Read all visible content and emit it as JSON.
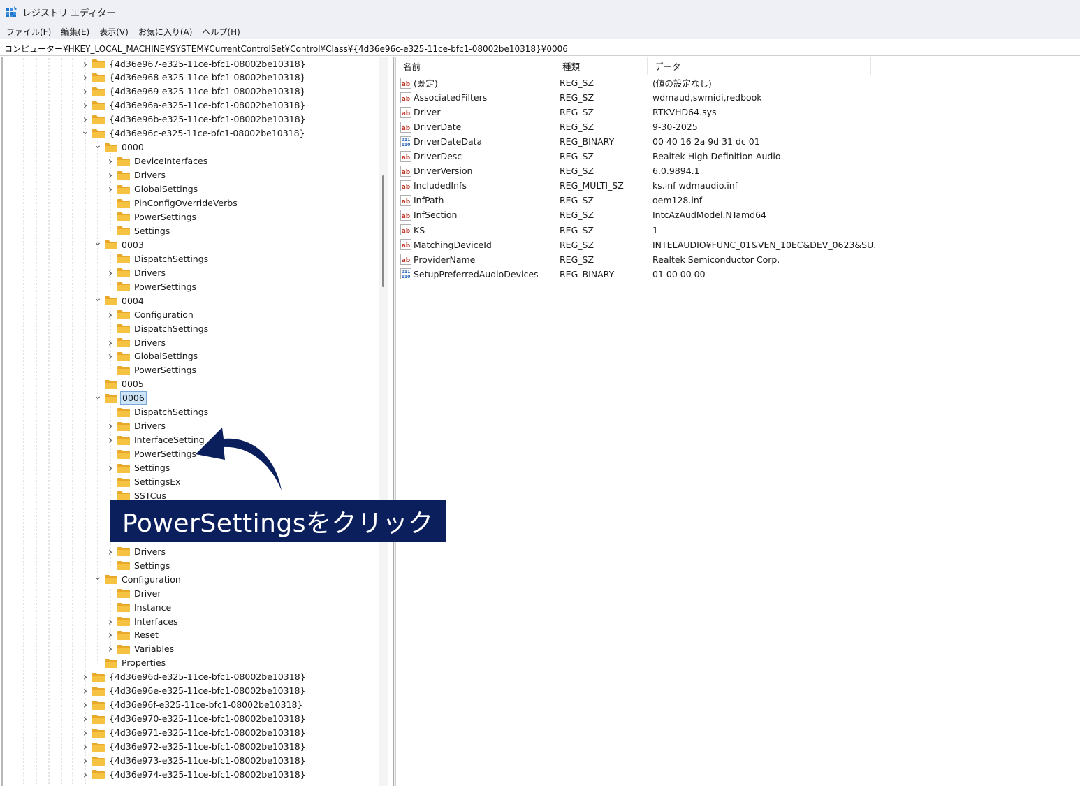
{
  "window": {
    "title": "レジストリ エディター"
  },
  "menu": [
    "ファイル(F)",
    "編集(E)",
    "表示(V)",
    "お気に入り(A)",
    "ヘルプ(H)"
  ],
  "address": "コンピューター¥HKEY_LOCAL_MACHINE¥SYSTEM¥CurrentControlSet¥Control¥Class¥{4d36e96c-e325-11ce-bfc1-08002be10318}¥0006",
  "tree": [
    {
      "label": "{4d36e967-e325-11ce-bfc1-08002be10318}",
      "level": 0,
      "chevron": "right"
    },
    {
      "label": "{4d36e968-e325-11ce-bfc1-08002be10318}",
      "level": 0,
      "chevron": "right"
    },
    {
      "label": "{4d36e969-e325-11ce-bfc1-08002be10318}",
      "level": 0,
      "chevron": "right"
    },
    {
      "label": "{4d36e96a-e325-11ce-bfc1-08002be10318}",
      "level": 0,
      "chevron": "right"
    },
    {
      "label": "{4d36e96b-e325-11ce-bfc1-08002be10318}",
      "level": 0,
      "chevron": "right"
    },
    {
      "label": "{4d36e96c-e325-11ce-bfc1-08002be10318}",
      "level": 0,
      "chevron": "down"
    },
    {
      "label": "0000",
      "level": 1,
      "chevron": "down"
    },
    {
      "label": "DeviceInterfaces",
      "level": 2,
      "chevron": "right"
    },
    {
      "label": "Drivers",
      "level": 2,
      "chevron": "right"
    },
    {
      "label": "GlobalSettings",
      "level": 2,
      "chevron": "right"
    },
    {
      "label": "PinConfigOverrideVerbs",
      "level": 2,
      "chevron": "none"
    },
    {
      "label": "PowerSettings",
      "level": 2,
      "chevron": "none"
    },
    {
      "label": "Settings",
      "level": 2,
      "chevron": "none"
    },
    {
      "label": "0003",
      "level": 1,
      "chevron": "down"
    },
    {
      "label": "DispatchSettings",
      "level": 2,
      "chevron": "none"
    },
    {
      "label": "Drivers",
      "level": 2,
      "chevron": "right"
    },
    {
      "label": "PowerSettings",
      "level": 2,
      "chevron": "none"
    },
    {
      "label": "0004",
      "level": 1,
      "chevron": "down"
    },
    {
      "label": "Configuration",
      "level": 2,
      "chevron": "right"
    },
    {
      "label": "DispatchSettings",
      "level": 2,
      "chevron": "none"
    },
    {
      "label": "Drivers",
      "level": 2,
      "chevron": "right"
    },
    {
      "label": "GlobalSettings",
      "level": 2,
      "chevron": "right"
    },
    {
      "label": "PowerSettings",
      "level": 2,
      "chevron": "none"
    },
    {
      "label": "0005",
      "level": 1,
      "chevron": "none"
    },
    {
      "label": "0006",
      "level": 1,
      "chevron": "down",
      "selected": true
    },
    {
      "label": "DispatchSettings",
      "level": 2,
      "chevron": "none"
    },
    {
      "label": "Drivers",
      "level": 2,
      "chevron": "right"
    },
    {
      "label": "InterfaceSetting",
      "level": 2,
      "chevron": "right"
    },
    {
      "label": "PowerSettings",
      "level": 2,
      "chevron": "none"
    },
    {
      "label": "Settings",
      "level": 2,
      "chevron": "right"
    },
    {
      "label": "SettingsEx",
      "level": 2,
      "chevron": "none"
    },
    {
      "label": "SSTCus",
      "level": 2,
      "chevron": "none"
    },
    {
      "label": "",
      "level": 2,
      "chevron": "none",
      "hidden": true
    },
    {
      "label": "",
      "level": 2,
      "chevron": "none",
      "hidden": true
    },
    {
      "label": "",
      "level": 1,
      "chevron": "down",
      "hidden": true
    },
    {
      "label": "Drivers",
      "level": 2,
      "chevron": "right"
    },
    {
      "label": "Settings",
      "level": 2,
      "chevron": "none"
    },
    {
      "label": "Configuration",
      "level": 1,
      "chevron": "down"
    },
    {
      "label": "Driver",
      "level": 2,
      "chevron": "none"
    },
    {
      "label": "Instance",
      "level": 2,
      "chevron": "none"
    },
    {
      "label": "Interfaces",
      "level": 2,
      "chevron": "right"
    },
    {
      "label": "Reset",
      "level": 2,
      "chevron": "right"
    },
    {
      "label": "Variables",
      "level": 2,
      "chevron": "right"
    },
    {
      "label": "Properties",
      "level": 1,
      "chevron": "none"
    },
    {
      "label": "{4d36e96d-e325-11ce-bfc1-08002be10318}",
      "level": 0,
      "chevron": "right"
    },
    {
      "label": "{4d36e96e-e325-11ce-bfc1-08002be10318}",
      "level": 0,
      "chevron": "right"
    },
    {
      "label": "{4d36e96f-e325-11ce-bfc1-08002be10318}",
      "level": 0,
      "chevron": "right"
    },
    {
      "label": "{4d36e970-e325-11ce-bfc1-08002be10318}",
      "level": 0,
      "chevron": "right"
    },
    {
      "label": "{4d36e971-e325-11ce-bfc1-08002be10318}",
      "level": 0,
      "chevron": "right"
    },
    {
      "label": "{4d36e972-e325-11ce-bfc1-08002be10318}",
      "level": 0,
      "chevron": "right"
    },
    {
      "label": "{4d36e973-e325-11ce-bfc1-08002be10318}",
      "level": 0,
      "chevron": "right"
    },
    {
      "label": "{4d36e974-e325-11ce-bfc1-08002be10318}",
      "level": 0,
      "chevron": "right"
    }
  ],
  "columns": {
    "name": "名前",
    "type": "種類",
    "data": "データ"
  },
  "values": [
    {
      "icon": "string-value-icon",
      "name": "(既定)",
      "type": "REG_SZ",
      "data": "(値の設定なし)"
    },
    {
      "icon": "string-value-icon",
      "name": "AssociatedFilters",
      "type": "REG_SZ",
      "data": "wdmaud,swmidi,redbook"
    },
    {
      "icon": "string-value-icon",
      "name": "Driver",
      "type": "REG_SZ",
      "data": "RTKVHD64.sys"
    },
    {
      "icon": "string-value-icon",
      "name": "DriverDate",
      "type": "REG_SZ",
      "data": "9-30-2025"
    },
    {
      "icon": "binary-value-icon",
      "name": "DriverDateData",
      "type": "REG_BINARY",
      "data": "00 40 16 2a 9d 31 dc 01"
    },
    {
      "icon": "string-value-icon",
      "name": "DriverDesc",
      "type": "REG_SZ",
      "data": "Realtek High Definition Audio"
    },
    {
      "icon": "string-value-icon",
      "name": "DriverVersion",
      "type": "REG_SZ",
      "data": "6.0.9894.1"
    },
    {
      "icon": "string-value-icon",
      "name": "IncludedInfs",
      "type": "REG_MULTI_SZ",
      "data": "ks.inf wdmaudio.inf"
    },
    {
      "icon": "string-value-icon",
      "name": "InfPath",
      "type": "REG_SZ",
      "data": "oem128.inf"
    },
    {
      "icon": "string-value-icon",
      "name": "InfSection",
      "type": "REG_SZ",
      "data": "IntcAzAudModel.NTamd64"
    },
    {
      "icon": "string-value-icon",
      "name": "KS",
      "type": "REG_SZ",
      "data": "1"
    },
    {
      "icon": "string-value-icon",
      "name": "MatchingDeviceId",
      "type": "REG_SZ",
      "data": "INTELAUDIO¥FUNC_01&VEN_10EC&DEV_0623&SU..."
    },
    {
      "icon": "string-value-icon",
      "name": "ProviderName",
      "type": "REG_SZ",
      "data": "Realtek Semiconductor Corp."
    },
    {
      "icon": "binary-value-icon",
      "name": "SetupPreferredAudioDevices",
      "type": "REG_BINARY",
      "data": "01 00 00 00"
    }
  ],
  "annotation": {
    "text": "PowerSettingsをクリック"
  },
  "colors": {
    "annotation_bg": "#0a1f5c",
    "folder": "#f5c242",
    "selected_bg": "#cce4f7"
  }
}
